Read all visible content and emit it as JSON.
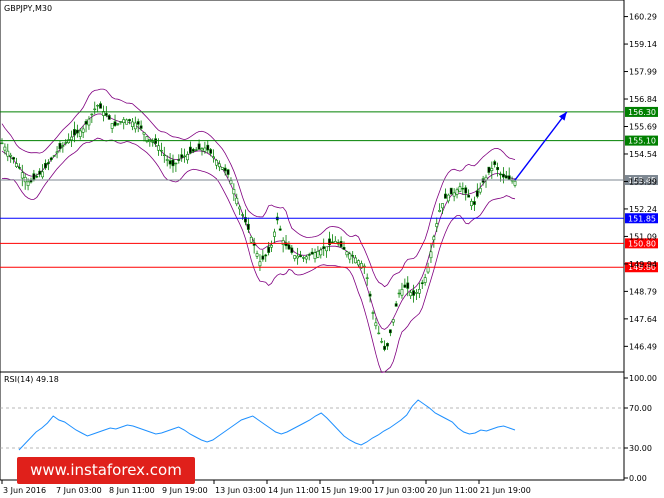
{
  "chart_data": [
    {
      "type": "candlestick",
      "title": "GBPJPY,M30",
      "ylim": [
        145.5,
        160.9
      ],
      "y_ticks": [
        "160.29",
        "159.14",
        "157.99",
        "156.84",
        "155.69",
        "154.54",
        "153.39",
        "152.24",
        "151.09",
        "149.94",
        "148.79",
        "147.64",
        "146.49"
      ],
      "x_ticks": [
        "3 Jun 2016",
        "7 Jun 03:00",
        "8 Jun 11:00",
        "9 Jun 19:00",
        "13 Jun 03:00",
        "14 Jun 11:00",
        "15 Jun 19:00",
        "17 Jun 03:00",
        "20 Jun 11:00",
        "21 Jun 19:00"
      ],
      "horizontal_levels": [
        {
          "value": 156.3,
          "label": "156.30",
          "color": "#008000"
        },
        {
          "value": 155.1,
          "label": "155.10",
          "color": "#008000"
        },
        {
          "value": 153.45,
          "label": "153.45",
          "color": "#7d8791"
        },
        {
          "value": 151.85,
          "label": "151.85",
          "color": "#0000ff"
        },
        {
          "value": 150.8,
          "label": "150.80",
          "color": "#ff0000"
        },
        {
          "value": 149.8,
          "label": "149.80",
          "color": "#ff0000"
        }
      ],
      "price_path": [
        [
          0,
          155.0
        ],
        [
          4,
          154.2
        ],
        [
          8,
          153.3
        ],
        [
          12,
          153.8
        ],
        [
          16,
          154.6
        ],
        [
          20,
          155.2
        ],
        [
          24,
          155.6
        ],
        [
          28,
          156.6
        ],
        [
          30,
          156.3
        ],
        [
          33,
          155.7
        ],
        [
          36,
          156.0
        ],
        [
          40,
          155.8
        ],
        [
          43,
          155.2
        ],
        [
          46,
          154.9
        ],
        [
          50,
          154.0
        ],
        [
          53,
          154.4
        ],
        [
          57,
          154.7
        ],
        [
          60,
          154.8
        ],
        [
          63,
          154.3
        ],
        [
          67,
          153.6
        ],
        [
          70,
          152.3
        ],
        [
          73,
          151.2
        ],
        [
          76,
          150.0
        ],
        [
          79,
          150.5
        ],
        [
          81,
          151.8
        ],
        [
          83,
          150.8
        ],
        [
          86,
          150.3
        ],
        [
          89,
          150.2
        ],
        [
          92,
          150.4
        ],
        [
          95,
          150.6
        ],
        [
          98,
          150.9
        ],
        [
          101,
          150.5
        ],
        [
          104,
          150.2
        ],
        [
          107,
          149.8
        ],
        [
          109,
          148.0
        ],
        [
          111,
          147.0
        ],
        [
          113,
          146.2
        ],
        [
          115,
          147.5
        ],
        [
          117,
          148.8
        ],
        [
          119,
          149.0
        ],
        [
          121,
          148.6
        ],
        [
          123,
          148.9
        ],
        [
          125,
          149.5
        ],
        [
          127,
          151.0
        ],
        [
          129,
          152.3
        ],
        [
          131,
          152.8
        ],
        [
          133,
          152.9
        ],
        [
          135,
          153.2
        ],
        [
          137,
          152.8
        ],
        [
          139,
          152.4
        ],
        [
          141,
          153.2
        ],
        [
          143,
          153.7
        ],
        [
          145,
          154.1
        ],
        [
          147,
          153.6
        ],
        [
          149,
          153.5
        ],
        [
          151,
          153.4
        ]
      ],
      "forecast_arrow": {
        "from": [
          151,
          153.45
        ],
        "to": [
          158,
          156.3
        ],
        "color": "#0000ff"
      },
      "bands_offset": 1.1,
      "x_count": 178,
      "colors": {
        "candle": "#008000",
        "bands": "#800080",
        "rsi": "#1e90ff",
        "levels_grid": "#000000"
      }
    },
    {
      "type": "line",
      "title": "RSI(14) 49.18",
      "ylim": [
        0,
        100
      ],
      "y_ticks": [
        "100.00",
        "70.00",
        "30.00",
        "0.00"
      ],
      "levels": [
        70,
        30
      ],
      "values": [
        28,
        34,
        40,
        46,
        50,
        55,
        62,
        58,
        56,
        52,
        48,
        45,
        42,
        44,
        46,
        48,
        50,
        49,
        51,
        53,
        52,
        50,
        48,
        46,
        44,
        45,
        47,
        49,
        51,
        48,
        44,
        41,
        38,
        36,
        38,
        42,
        46,
        50,
        54,
        58,
        60,
        62,
        58,
        54,
        50,
        46,
        44,
        46,
        49,
        52,
        55,
        58,
        62,
        65,
        60,
        54,
        48,
        42,
        38,
        35,
        33,
        36,
        40,
        43,
        47,
        50,
        54,
        58,
        63,
        72,
        78,
        74,
        70,
        65,
        62,
        59,
        56,
        50,
        46,
        44,
        45,
        48,
        47,
        49,
        51,
        52,
        50,
        48
      ],
      "last_value": 49.18
    }
  ],
  "watermark": {
    "text": "www.instaforex.com"
  }
}
